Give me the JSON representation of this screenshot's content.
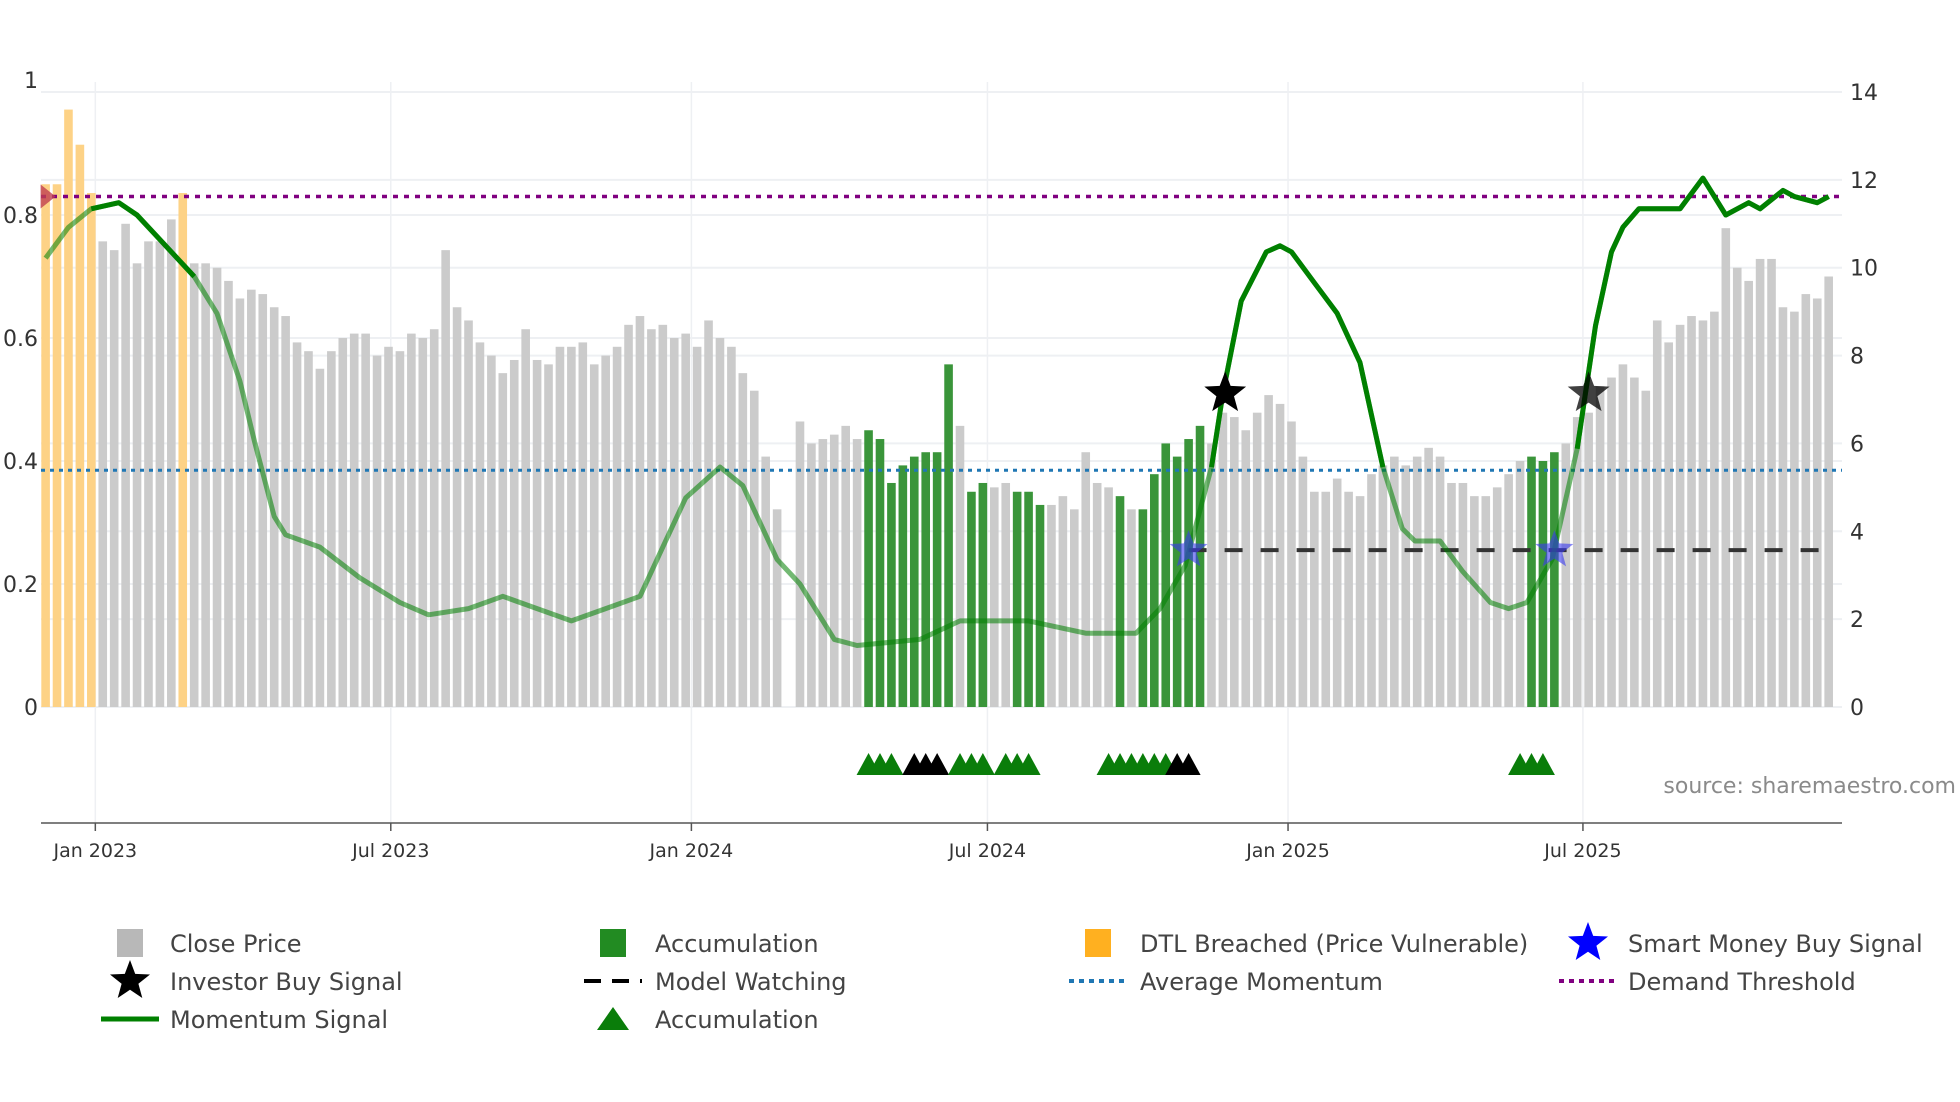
{
  "chart_data": {
    "type": "bar",
    "title": "",
    "source": "source: sharemaestro.com",
    "left_axis": {
      "range": [
        0,
        1
      ],
      "ticks": [
        "0",
        "0.2",
        "0.4",
        "0.6",
        "0.8",
        "1"
      ],
      "tick_values": [
        0,
        0.2,
        0.4,
        0.6,
        0.8,
        1
      ]
    },
    "right_axis": {
      "range": [
        0,
        14
      ],
      "ticks": [
        "0",
        "2",
        "4",
        "6",
        "8",
        "10",
        "12",
        "14"
      ],
      "tick_values": [
        0,
        2,
        4,
        6,
        8,
        10,
        12,
        14
      ]
    },
    "x_axis": {
      "unit": "weekly bar index",
      "ticks": [
        {
          "label": "Jan 2023",
          "index": 4.35
        },
        {
          "label": "Jul 2023",
          "index": 30.2
        },
        {
          "label": "Jan 2024",
          "index": 56.5
        },
        {
          "label": "Jul 2024",
          "index": 82.4
        },
        {
          "label": "Jan 2025",
          "index": 108.7
        },
        {
          "label": "Jul 2025",
          "index": 134.5
        }
      ]
    },
    "close_price": [
      11.9,
      11.9,
      13.6,
      12.8,
      11.7,
      10.6,
      10.4,
      11.0,
      10.1,
      10.6,
      10.6,
      11.1,
      11.7,
      10.1,
      10.1,
      10.0,
      9.7,
      9.3,
      9.5,
      9.4,
      9.1,
      8.9,
      8.3,
      8.1,
      7.7,
      8.1,
      8.4,
      8.5,
      8.5,
      8.0,
      8.2,
      8.1,
      8.5,
      8.4,
      8.6,
      10.4,
      9.1,
      8.8,
      8.3,
      8.0,
      7.6,
      7.9,
      8.6,
      7.9,
      7.8,
      8.2,
      8.2,
      8.3,
      7.8,
      8.0,
      8.2,
      8.7,
      8.9,
      8.6,
      8.7,
      8.4,
      8.5,
      8.2,
      8.8,
      8.4,
      8.2,
      7.6,
      7.2,
      5.7,
      4.5,
      null,
      6.5,
      6.0,
      6.1,
      6.2,
      6.4,
      6.1,
      6.3,
      6.1,
      5.1,
      5.5,
      5.7,
      5.8,
      5.8,
      7.8,
      6.4,
      4.9,
      5.1,
      5.0,
      5.1,
      4.9,
      4.9,
      4.6,
      4.6,
      4.8,
      4.5,
      5.8,
      5.1,
      5.0,
      4.8,
      4.5,
      4.5,
      5.3,
      6.0,
      5.7,
      6.1,
      6.4,
      6.0,
      6.7,
      6.6,
      6.3,
      6.7,
      7.1,
      6.9,
      6.5,
      5.7,
      4.9,
      4.9,
      5.2,
      4.9,
      4.8,
      5.3,
      5.5,
      5.7,
      5.5,
      5.7,
      5.9,
      5.7,
      5.1,
      5.1,
      4.8,
      4.8,
      5.0,
      5.3,
      5.6,
      5.7,
      5.6,
      5.8,
      6.0,
      6.6,
      6.7,
      7.3,
      7.5,
      7.8,
      7.5,
      7.2,
      8.8,
      8.3,
      8.7,
      8.9,
      8.8,
      9.0,
      10.9,
      10.0,
      9.7,
      10.2,
      10.2,
      9.1,
      9.0,
      9.4,
      9.3,
      9.8
    ],
    "dtl_breached_bars": [
      0,
      1,
      2,
      3,
      4,
      12
    ],
    "accumulation_bars": [
      72,
      73,
      74,
      75,
      76,
      77,
      78,
      79,
      81,
      82,
      85,
      86,
      87,
      94,
      96,
      97,
      98,
      99,
      100,
      101,
      130,
      131,
      132
    ],
    "momentum_signal": [
      [
        0,
        0.73
      ],
      [
        2,
        0.78
      ],
      [
        4,
        0.81
      ],
      [
        6.4,
        0.82
      ],
      [
        8,
        0.8
      ],
      [
        10,
        0.76
      ],
      [
        13,
        0.7
      ],
      [
        15,
        0.64
      ],
      [
        17,
        0.53
      ],
      [
        18.3,
        0.43
      ],
      [
        20,
        0.31
      ],
      [
        21,
        0.28
      ],
      [
        24,
        0.26
      ],
      [
        27.5,
        0.21
      ],
      [
        31,
        0.17
      ],
      [
        33.5,
        0.15
      ],
      [
        37,
        0.16
      ],
      [
        40,
        0.18
      ],
      [
        43,
        0.16
      ],
      [
        46,
        0.14
      ],
      [
        49,
        0.16
      ],
      [
        52,
        0.18
      ],
      [
        54,
        0.26
      ],
      [
        56,
        0.34
      ],
      [
        59,
        0.39
      ],
      [
        61,
        0.36
      ],
      [
        64,
        0.24
      ],
      [
        66,
        0.2
      ],
      [
        69,
        0.11
      ],
      [
        71,
        0.1
      ],
      [
        76.5,
        0.11
      ],
      [
        80,
        0.14
      ],
      [
        86,
        0.14
      ],
      [
        91,
        0.12
      ],
      [
        95.4,
        0.12
      ],
      [
        97.5,
        0.16
      ],
      [
        99.7,
        0.23
      ],
      [
        102,
        0.39
      ],
      [
        103,
        0.51
      ],
      [
        104.6,
        0.66
      ],
      [
        106.8,
        0.74
      ],
      [
        108,
        0.75
      ],
      [
        109,
        0.74
      ],
      [
        111,
        0.69
      ],
      [
        113,
        0.64
      ],
      [
        115,
        0.56
      ],
      [
        117,
        0.39
      ],
      [
        118.7,
        0.29
      ],
      [
        119.8,
        0.27
      ],
      [
        122,
        0.27
      ],
      [
        124,
        0.22
      ],
      [
        126.4,
        0.17
      ],
      [
        128,
        0.16
      ],
      [
        129.6,
        0.17
      ],
      [
        131.8,
        0.24
      ],
      [
        134,
        0.42
      ],
      [
        135.6,
        0.62
      ],
      [
        137,
        0.74
      ],
      [
        138,
        0.78
      ],
      [
        139.4,
        0.81
      ],
      [
        141,
        0.81
      ],
      [
        143,
        0.81
      ],
      [
        145,
        0.86
      ],
      [
        147,
        0.8
      ],
      [
        149,
        0.82
      ],
      [
        150,
        0.81
      ],
      [
        152,
        0.84
      ],
      [
        153,
        0.83
      ],
      [
        155,
        0.82
      ],
      [
        156,
        0.83
      ]
    ],
    "momentum_emphasized_ranges": [
      [
        4,
        14
      ],
      [
        100,
        117
      ],
      [
        133,
        156
      ]
    ],
    "average_momentum": 0.385,
    "demand_threshold": 0.83,
    "model_watching": {
      "value": 0.255,
      "from_index": 100,
      "to_index": 156
    },
    "smart_money_buy_signals": [
      [
        100,
        0.255
      ],
      [
        132,
        0.255
      ]
    ],
    "investor_buy_signals": [
      [
        103.2,
        0.51
      ],
      [
        135,
        0.51
      ]
    ],
    "start_marker": [
      0,
      0.83
    ],
    "accumulation_triangles": [
      {
        "index": 72,
        "color": "green"
      },
      {
        "index": 73,
        "color": "green"
      },
      {
        "index": 74,
        "color": "green"
      },
      {
        "index": 76,
        "color": "black"
      },
      {
        "index": 77,
        "color": "black"
      },
      {
        "index": 78,
        "color": "black"
      },
      {
        "index": 80,
        "color": "green"
      },
      {
        "index": 81,
        "color": "green"
      },
      {
        "index": 82,
        "color": "green"
      },
      {
        "index": 84,
        "color": "green"
      },
      {
        "index": 85,
        "color": "green"
      },
      {
        "index": 86,
        "color": "green"
      },
      {
        "index": 93,
        "color": "green"
      },
      {
        "index": 94,
        "color": "green"
      },
      {
        "index": 95,
        "color": "green"
      },
      {
        "index": 96,
        "color": "green"
      },
      {
        "index": 97,
        "color": "green"
      },
      {
        "index": 98,
        "color": "green"
      },
      {
        "index": 99,
        "color": "black"
      },
      {
        "index": 100,
        "color": "black"
      },
      {
        "index": 129,
        "color": "green"
      },
      {
        "index": 130,
        "color": "green"
      },
      {
        "index": 131,
        "color": "green"
      }
    ],
    "legend": [
      {
        "label": "Close Price",
        "symbol": "gray-square"
      },
      {
        "label": "Accumulation",
        "symbol": "green-square"
      },
      {
        "label": "DTL Breached (Price Vulnerable)",
        "symbol": "orange-square"
      },
      {
        "label": "Smart Money Buy Signal",
        "symbol": "blue-star"
      },
      {
        "label": "Investor Buy Signal",
        "symbol": "black-star"
      },
      {
        "label": "Model Watching",
        "symbol": "black-dash"
      },
      {
        "label": "Average Momentum",
        "symbol": "blue-dot"
      },
      {
        "label": "Demand Threshold",
        "symbol": "purple-dot"
      },
      {
        "label": "Momentum Signal",
        "symbol": "green-line"
      },
      {
        "label": "Accumulation",
        "symbol": "green-triangle"
      }
    ],
    "legend_placement": "bottom",
    "grid": true,
    "colors": {
      "close": "#c8c8c8",
      "accumulation": "#2f8f2f",
      "dtl": "#fdd080",
      "momentum": "#008000",
      "average": "#1f77b4",
      "threshold": "#800080",
      "smart_money": "#3a3af0",
      "investor": "#000000"
    }
  }
}
